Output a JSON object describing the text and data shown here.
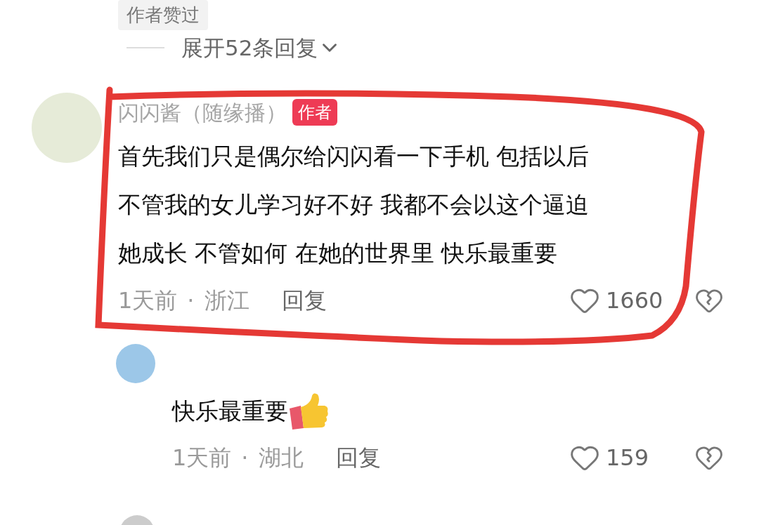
{
  "liked_badge": "作者赞过",
  "expand_replies": "展开52条回复",
  "comment": {
    "author": "闪闪酱（随缘播）",
    "author_badge": "作者",
    "text": [
      "首先我们只是偶尔给闪闪看一下手机 包括以后",
      "不管我的女儿学习好不好 我都不会以这个逼迫",
      "她成长 不管如何 在她的世界里 快乐最重要"
    ],
    "time": "1天前",
    "separator": "·",
    "location": "浙江",
    "reply": "回复",
    "likes": "1660"
  },
  "reply": {
    "text": "快乐最重要",
    "time": "1天前",
    "separator": "·",
    "location": "湖北",
    "reply": "回复",
    "likes": "159"
  }
}
